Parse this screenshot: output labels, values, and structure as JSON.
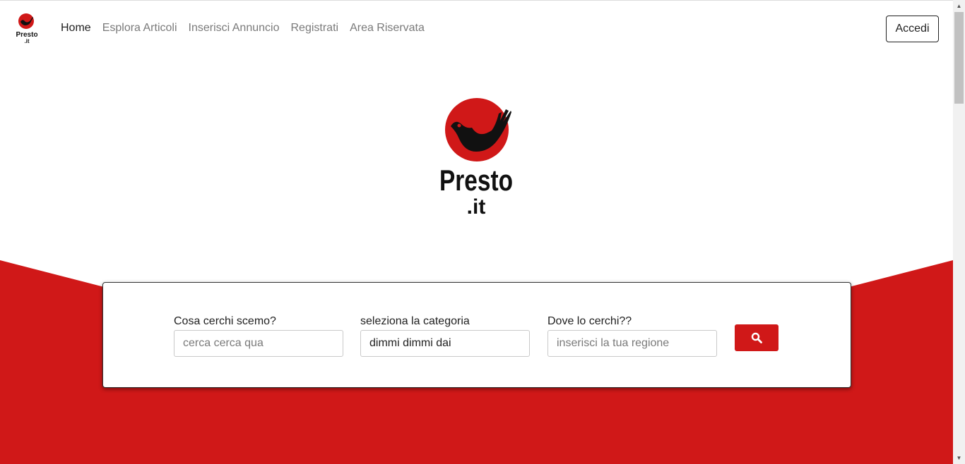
{
  "brand": {
    "name": "Presto",
    "tld": ".it",
    "color": "#d01818"
  },
  "nav": {
    "items": [
      {
        "label": "Home",
        "active": true
      },
      {
        "label": "Esplora Articoli",
        "active": false
      },
      {
        "label": "Inserisci Annuncio",
        "active": false
      },
      {
        "label": "Registrati",
        "active": false
      },
      {
        "label": "Area Riservata",
        "active": false
      }
    ],
    "login_label": "Accedi"
  },
  "search": {
    "what": {
      "label": "Cosa cerchi scemo?",
      "placeholder": "cerca cerca qua",
      "value": ""
    },
    "category": {
      "label": "seleziona la categoria",
      "value": "dimmi dimmi dai"
    },
    "where": {
      "label": "Dove lo cerchi??",
      "placeholder": "inserisci la tua regione",
      "value": ""
    },
    "button_icon": "search-icon"
  }
}
